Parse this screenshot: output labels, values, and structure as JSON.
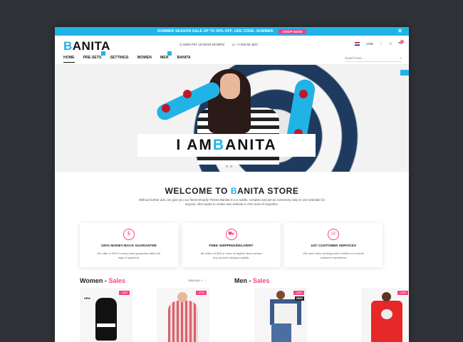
{
  "promo": {
    "text": "SUMMER SEASON SALE UP TO 50% OFF. USE CODE: SUMMER.",
    "button": "SHOP NOW",
    "close": "✕"
  },
  "header": {
    "logo_first": "B",
    "logo_rest": "ANITA",
    "hours": "MON-FRI: 10:00AM-18:00PM",
    "phone": "+7 849 55 4267",
    "currency": "USD",
    "cart_count": "0"
  },
  "nav": {
    "items": [
      "HOME",
      "PRE-SETS",
      "SETTINGS",
      "WOMEN",
      "MEN",
      "BANITA"
    ],
    "search_placeholder": "Search here ..."
  },
  "hero": {
    "title_a": "I AM ",
    "title_b": "B",
    "title_c": "ANITA"
  },
  "welcome": {
    "title_a": "WELCOME TO ",
    "title_b": "B",
    "title_c": "ANITA STORE",
    "text": "Without further ado, we give you our finest Shopify Theme Banita! It is a subtle, complex and yet an extremely easy to use template for anyone, who wants to create own website in ANY area of expertise."
  },
  "features": [
    {
      "icon": "dollar-icon",
      "glyph": "$",
      "title": "100% MONEY-BACK GUARANTEE",
      "text": "We offer a 100% money-back guarantee within 60 days of payment."
    },
    {
      "icon": "truck-icon",
      "glyph": "⛟",
      "title": "FREE SHIPPING/DELIVERY",
      "text": "All orders of $35 or more of eligible items across any product category qualify."
    },
    {
      "icon": "support-icon",
      "glyph": "☏",
      "title": "24/7 CUSTOMER SERVICES",
      "text": "We have been working hard to better our overall customer experience"
    }
  ],
  "sales": {
    "women_a": "Women - ",
    "women_b": "Sales",
    "men_a": "Men - ",
    "men_b": "Sales",
    "view_all": "VIEW ALL",
    "discount": "-45%",
    "new": "NEW"
  },
  "colors": {
    "accent": "#22b3e6",
    "pink": "#ff3f84"
  }
}
